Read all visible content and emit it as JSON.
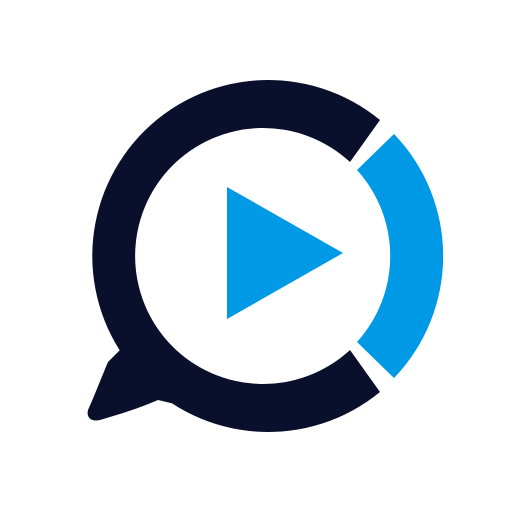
{
  "app_icon": {
    "icon": "chat-video-play-logo",
    "colors": {
      "background": "#ffffff",
      "ring": "#0a0f2b",
      "accent": "#0099e5",
      "play": "#0099e5"
    }
  }
}
